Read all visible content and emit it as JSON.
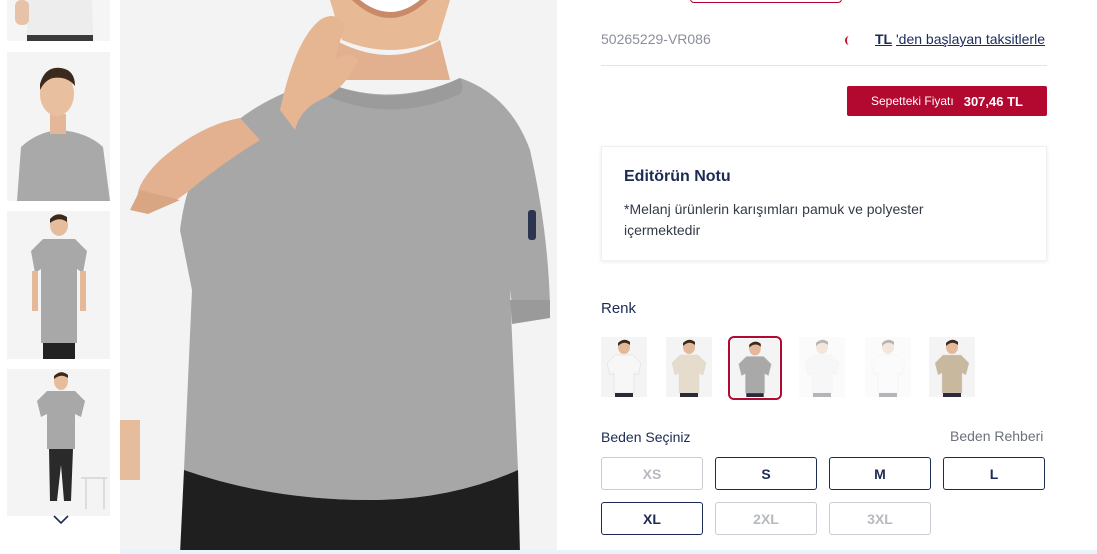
{
  "product": {
    "sku": "50265229-VR086",
    "installment_currency": "TL",
    "installment_text": "'den başlayan taksitlerle"
  },
  "basket_price": {
    "label": "Sepetteki Fiyatı",
    "amount": "307,46 TL"
  },
  "editor_note": {
    "title": "Editörün Notu",
    "text": "*Melanj ürünlerin karışımları pamuk ve polyester içermektedir"
  },
  "color": {
    "label": "Renk",
    "swatches": [
      {
        "name": "white",
        "shirt_color": "#f7f7f7",
        "selected": false
      },
      {
        "name": "beige",
        "shirt_color": "#e6dccb",
        "selected": false
      },
      {
        "name": "grey-melange",
        "shirt_color": "#a9a9a9",
        "selected": true
      },
      {
        "name": "light-grey",
        "shirt_color": "#e9e9e9",
        "selected": false
      },
      {
        "name": "white-2",
        "shirt_color": "#f4f4f4",
        "selected": false
      },
      {
        "name": "sand",
        "shirt_color": "#c8b89e",
        "selected": false
      }
    ]
  },
  "size": {
    "label": "Beden Seçiniz",
    "guide_label": "Beden Rehberi",
    "options": [
      {
        "label": "XS",
        "available": false
      },
      {
        "label": "S",
        "available": true
      },
      {
        "label": "M",
        "available": true
      },
      {
        "label": "L",
        "available": true
      },
      {
        "label": "XL",
        "available": true
      },
      {
        "label": "2XL",
        "available": false
      },
      {
        "label": "3XL",
        "available": false
      }
    ]
  },
  "colors": {
    "brand_red": "#b3082f",
    "navy": "#1c2b52",
    "product_grey": "#a7a7a7"
  },
  "icons": {
    "thumb_nav": "chevron-down-icon"
  }
}
